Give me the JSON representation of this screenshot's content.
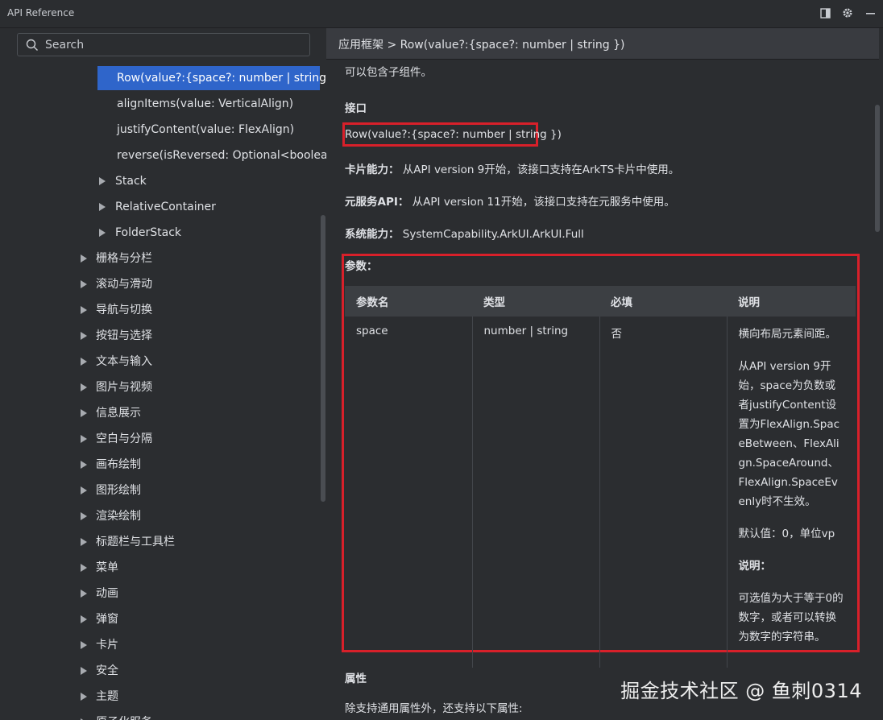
{
  "window": {
    "title": "API Reference"
  },
  "search": {
    "placeholder": "Search"
  },
  "sidebar": {
    "items": [
      {
        "label": "Row(value?:{space?: number | string })",
        "selected": true,
        "arrow": false
      },
      {
        "label": "alignItems(value: VerticalAlign)",
        "arrow": false
      },
      {
        "label": "justifyContent(value: FlexAlign)",
        "arrow": false
      },
      {
        "label": "reverse(isReversed: Optional<boolean>)",
        "arrow": false
      },
      {
        "label": "Stack",
        "arrow": true
      },
      {
        "label": "RelativeContainer",
        "arrow": true
      },
      {
        "label": "FolderStack",
        "arrow": true
      },
      {
        "label": "栅格与分栏",
        "arrow": true
      },
      {
        "label": "滚动与滑动",
        "arrow": true
      },
      {
        "label": "导航与切换",
        "arrow": true
      },
      {
        "label": "按钮与选择",
        "arrow": true
      },
      {
        "label": "文本与输入",
        "arrow": true
      },
      {
        "label": "图片与视频",
        "arrow": true
      },
      {
        "label": "信息展示",
        "arrow": true
      },
      {
        "label": "空白与分隔",
        "arrow": true
      },
      {
        "label": "画布绘制",
        "arrow": true
      },
      {
        "label": "图形绘制",
        "arrow": true
      },
      {
        "label": "渲染绘制",
        "arrow": true
      },
      {
        "label": "标题栏与工具栏",
        "arrow": true
      },
      {
        "label": "菜单",
        "arrow": true
      },
      {
        "label": "动画",
        "arrow": true
      },
      {
        "label": "弹窗",
        "arrow": true
      },
      {
        "label": "卡片",
        "arrow": true
      },
      {
        "label": "安全",
        "arrow": true
      },
      {
        "label": "主题",
        "arrow": true
      },
      {
        "label": "原子化服务",
        "arrow": true
      }
    ]
  },
  "content": {
    "breadcrumb": "应用框架 > Row(value?:{space?: number | string })",
    "intro": "可以包含子组件。",
    "interface_heading": "接口",
    "signature": "Row(value?:{space?: number | string })",
    "card_label": "卡片能力：",
    "card_text": "从API version 9开始，该接口支持在ArkTS卡片中使用。",
    "meta_label": "元服务API：",
    "meta_text": "从API version 11开始，该接口支持在元服务中使用。",
    "sys_label": "系统能力：",
    "sys_text": "SystemCapability.ArkUI.ArkUI.Full",
    "params_heading": "参数：",
    "table": {
      "headers": [
        "参数名",
        "类型",
        "必填",
        "说明"
      ],
      "row": {
        "name": "space",
        "type": "number | string",
        "required": "否",
        "desc1": "横向布局元素间距。",
        "desc2": "从API version 9开始，space为负数或者justifyContent设置为FlexAlign.SpaceBetween、FlexAlign.SpaceAround、FlexAlign.SpaceEvenly时不生效。",
        "desc3": "默认值：0，单位vp",
        "desc4": "说明：",
        "desc5": "可选值为大于等于0的数字，或者可以转换为数字的字符串。"
      }
    },
    "attr_heading": "属性",
    "attr_text": "除支持通用属性外，还支持以下属性:"
  },
  "watermark": "掘金技术社区 @ 鱼刺0314",
  "colors": {
    "accent": "#2f65ca",
    "highlight": "#d8202a",
    "background": "#2b2d30"
  },
  "icons": [
    "restore-icon",
    "gear-icon",
    "minimize-icon",
    "search-icon",
    "tree-arrow-icon"
  ]
}
